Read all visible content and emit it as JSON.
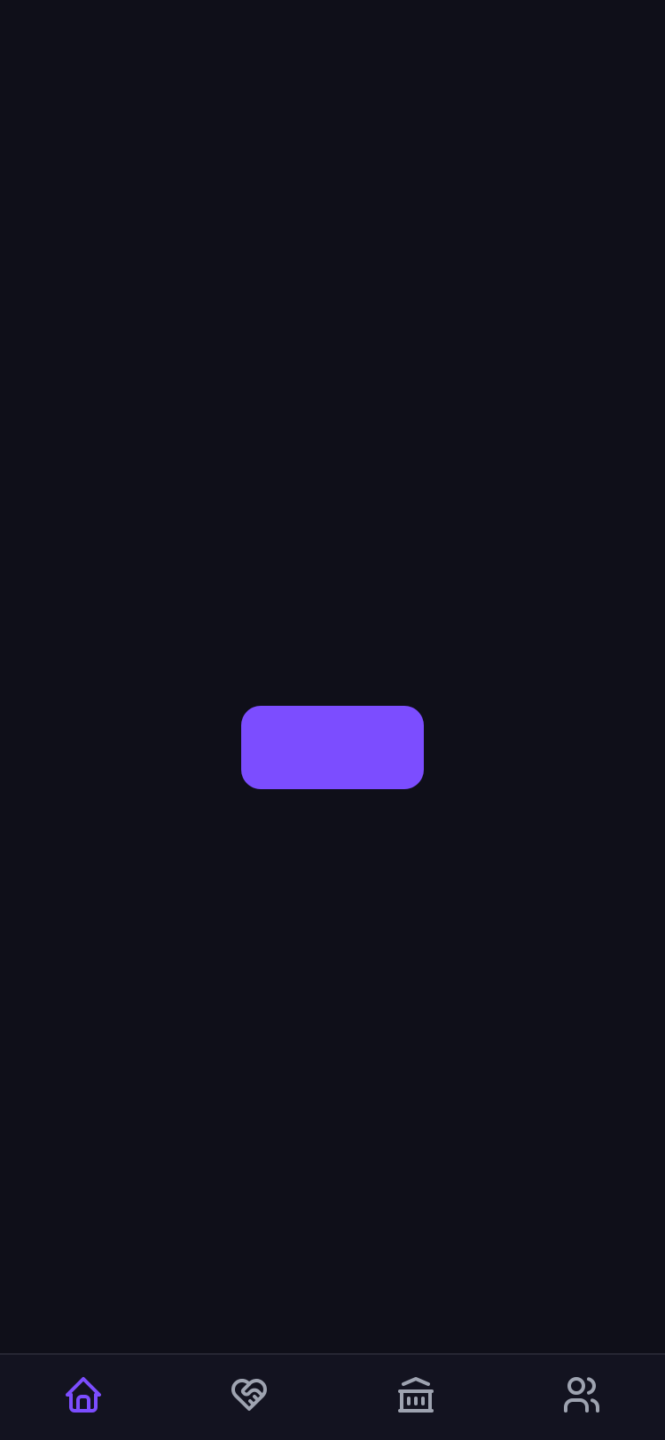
{
  "theme": {
    "background": "#0f0f19",
    "nav_background": "#131320",
    "accent": "#7c4dff",
    "inactive_icon": "#9ea3b0"
  },
  "main": {
    "center_button": {
      "label": "",
      "color": "#7c4dff"
    }
  },
  "bottom_nav": {
    "active_index": 0,
    "items": [
      {
        "icon": "home-icon"
      },
      {
        "icon": "heart-handshake-icon"
      },
      {
        "icon": "bank-icon"
      },
      {
        "icon": "users-icon"
      }
    ]
  }
}
